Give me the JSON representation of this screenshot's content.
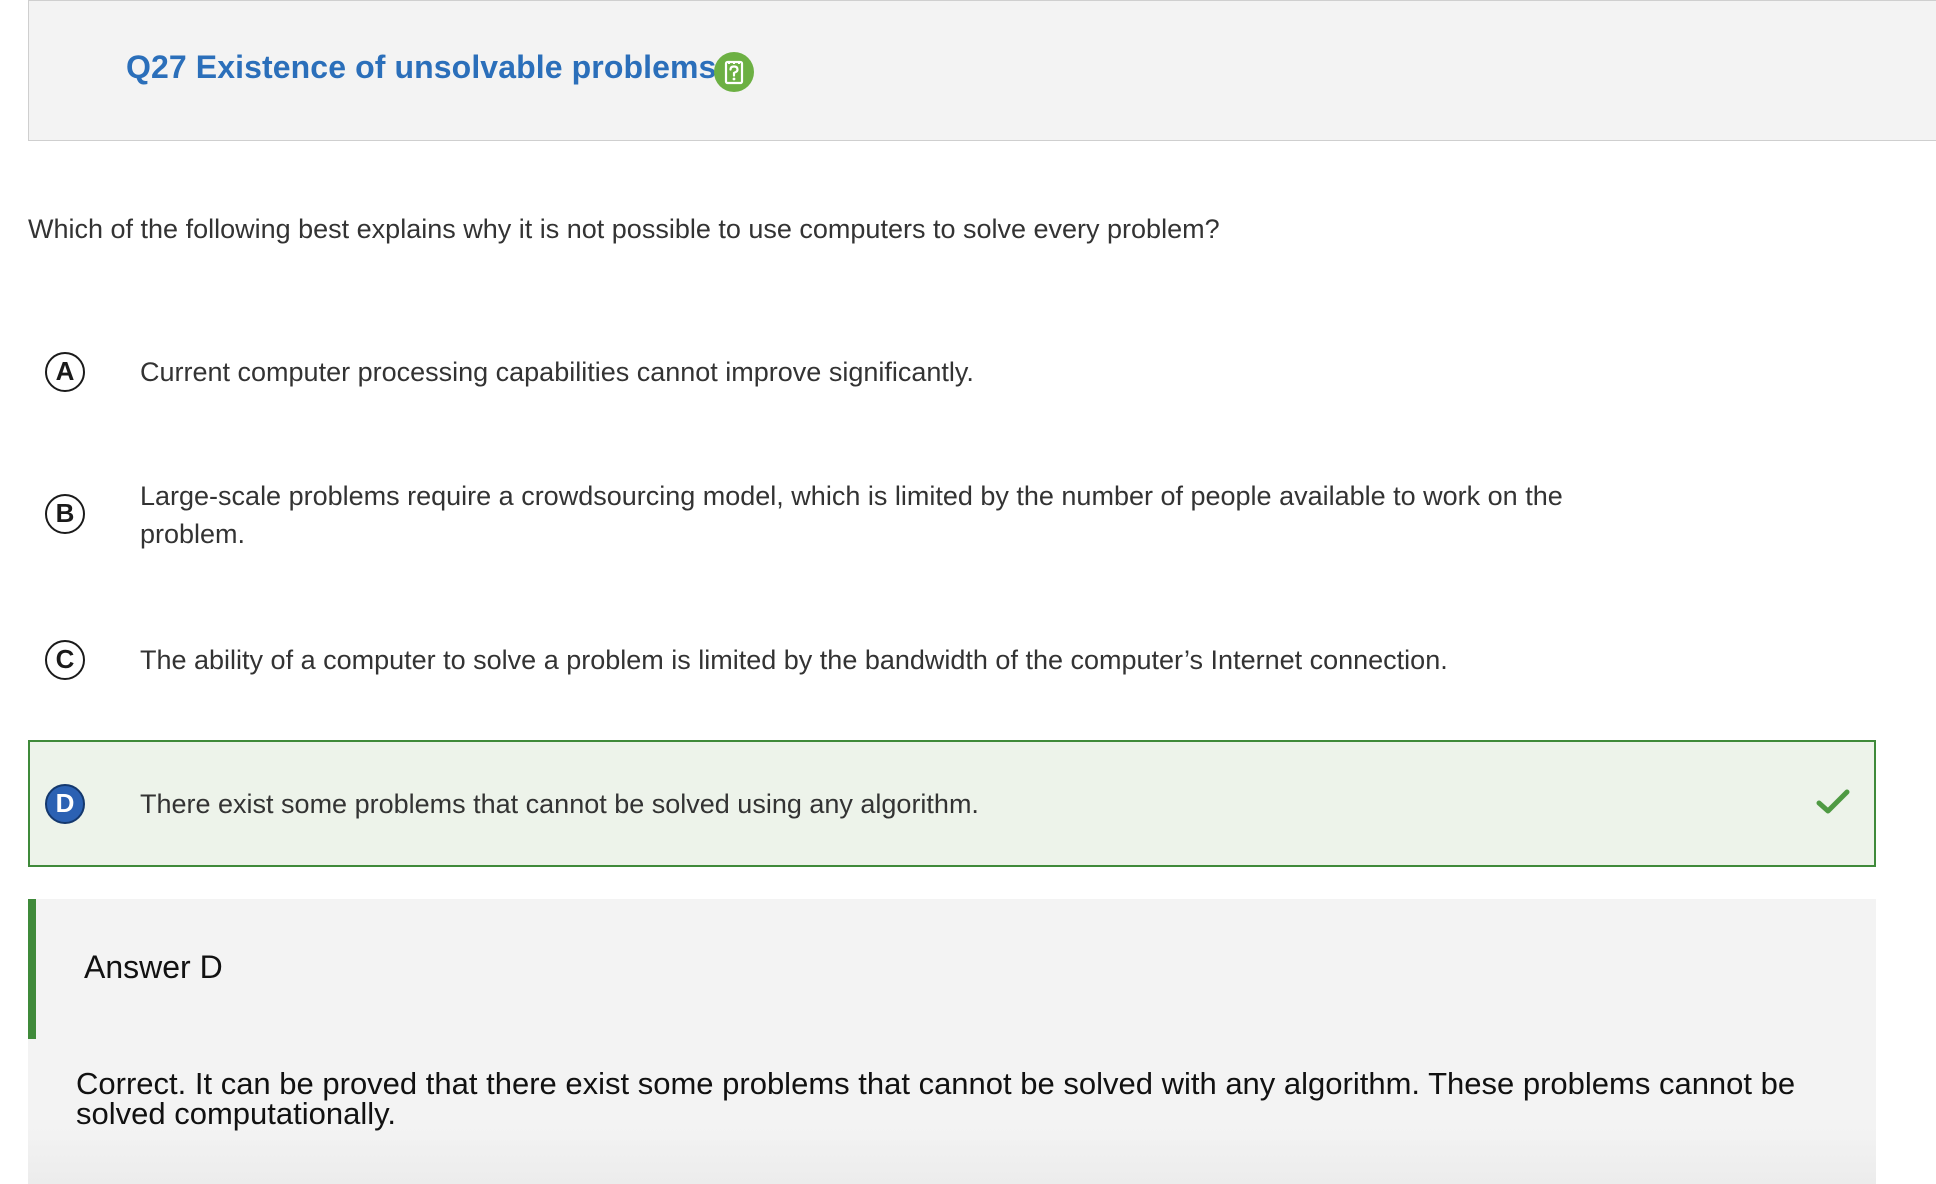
{
  "header": {
    "title": "Q27 Existence of unsolvable problems",
    "help_icon": "help-question-icon"
  },
  "question": {
    "text": "Which of the following best explains why it is not possible to use computers to solve every problem?"
  },
  "options": [
    {
      "letter": "A",
      "text": "Current computer processing capabilities cannot improve significantly."
    },
    {
      "letter": "B",
      "text": "Large-scale problems require a crowdsourcing model, which is limited by the number of people available to work on the problem."
    },
    {
      "letter": "C",
      "text": "The ability of a computer to solve a problem is limited by the bandwidth of the computer’s Internet connection."
    },
    {
      "letter": "D",
      "text": "There exist some problems that cannot be solved using any algorithm.",
      "selected": true,
      "correct": true
    }
  ],
  "answer": {
    "label": "Answer D",
    "explanation": "Correct. It can be proved that there exist some problems that cannot be solved with any algorithm. These problems cannot be solved computationally."
  },
  "colors": {
    "title": "#2b6fba",
    "help_icon": "#6cb043",
    "correct_border": "#3f8a3a",
    "correct_fill": "#edf3ea",
    "selected_badge": "#2b61b3"
  }
}
